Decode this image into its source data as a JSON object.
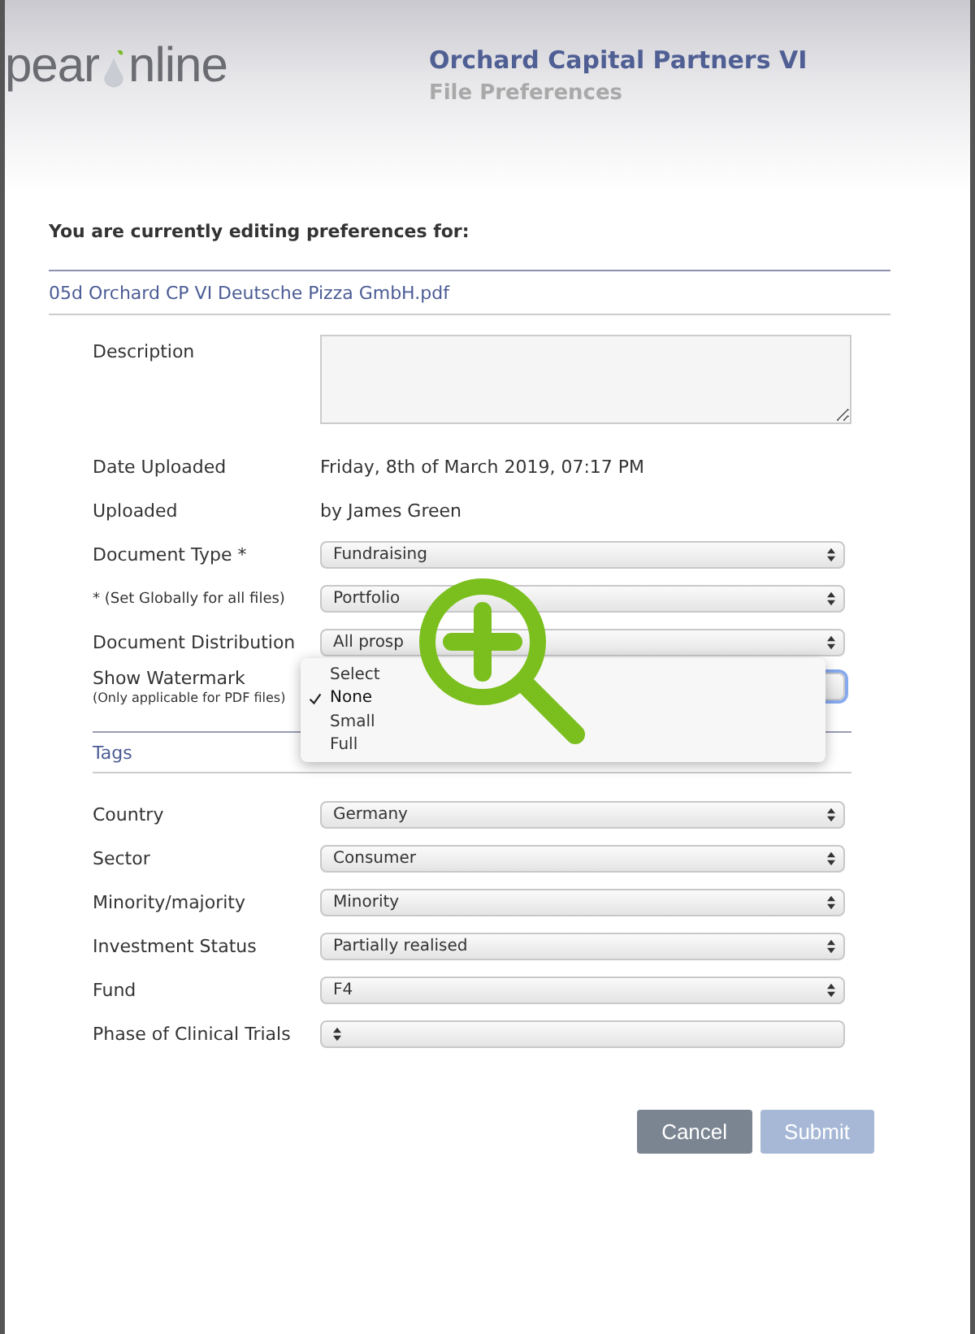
{
  "header": {
    "logo_left": "pear",
    "logo_right": "nline",
    "title": "Orchard Capital Partners VI",
    "subtitle": "File Preferences"
  },
  "intro": "You are currently editing preferences for:",
  "file_name": "05d Orchard CP VI Deutsche Pizza GmbH.pdf",
  "fields": [
    {
      "kind": "textarea",
      "label": "Description"
    },
    {
      "kind": "text",
      "label": "Date Uploaded",
      "value": "Friday, 8th of March 2019, 07:17 PM"
    },
    {
      "kind": "text",
      "label": "Uploaded",
      "value": "by James Green"
    },
    {
      "kind": "select",
      "label": "Document Type *",
      "value": "Fundraising",
      "focused": false
    },
    {
      "kind": "select",
      "label": "* (Set Globally for all files)",
      "small": true,
      "value": "Portfolio",
      "focused": false
    },
    {
      "kind": "select",
      "label": "Document Distribution",
      "value": "All prosp",
      "focused": false
    },
    {
      "kind": "dropdown",
      "label": "Show Watermark",
      "note": "(Only applicable for PDF files)",
      "focused": true,
      "options": [
        {
          "label": "Select",
          "selected": false
        },
        {
          "label": "None",
          "selected": true
        },
        {
          "label": "Small",
          "selected": false
        },
        {
          "label": "Full",
          "selected": false
        }
      ]
    }
  ],
  "tags_heading": "Tags",
  "tags": [
    {
      "label": "Country",
      "value": "Germany"
    },
    {
      "label": "Sector",
      "value": "Consumer"
    },
    {
      "label": "Minority/majority",
      "value": "Minority"
    },
    {
      "label": "Investment Status",
      "value": "Partially realised"
    },
    {
      "label": "Fund",
      "value": "F4"
    },
    {
      "label": "Phase of Clinical Trials"
    }
  ],
  "buttons": [
    {
      "label": "Cancel",
      "disabled": false
    },
    {
      "label": "Submit",
      "disabled": true
    }
  ]
}
